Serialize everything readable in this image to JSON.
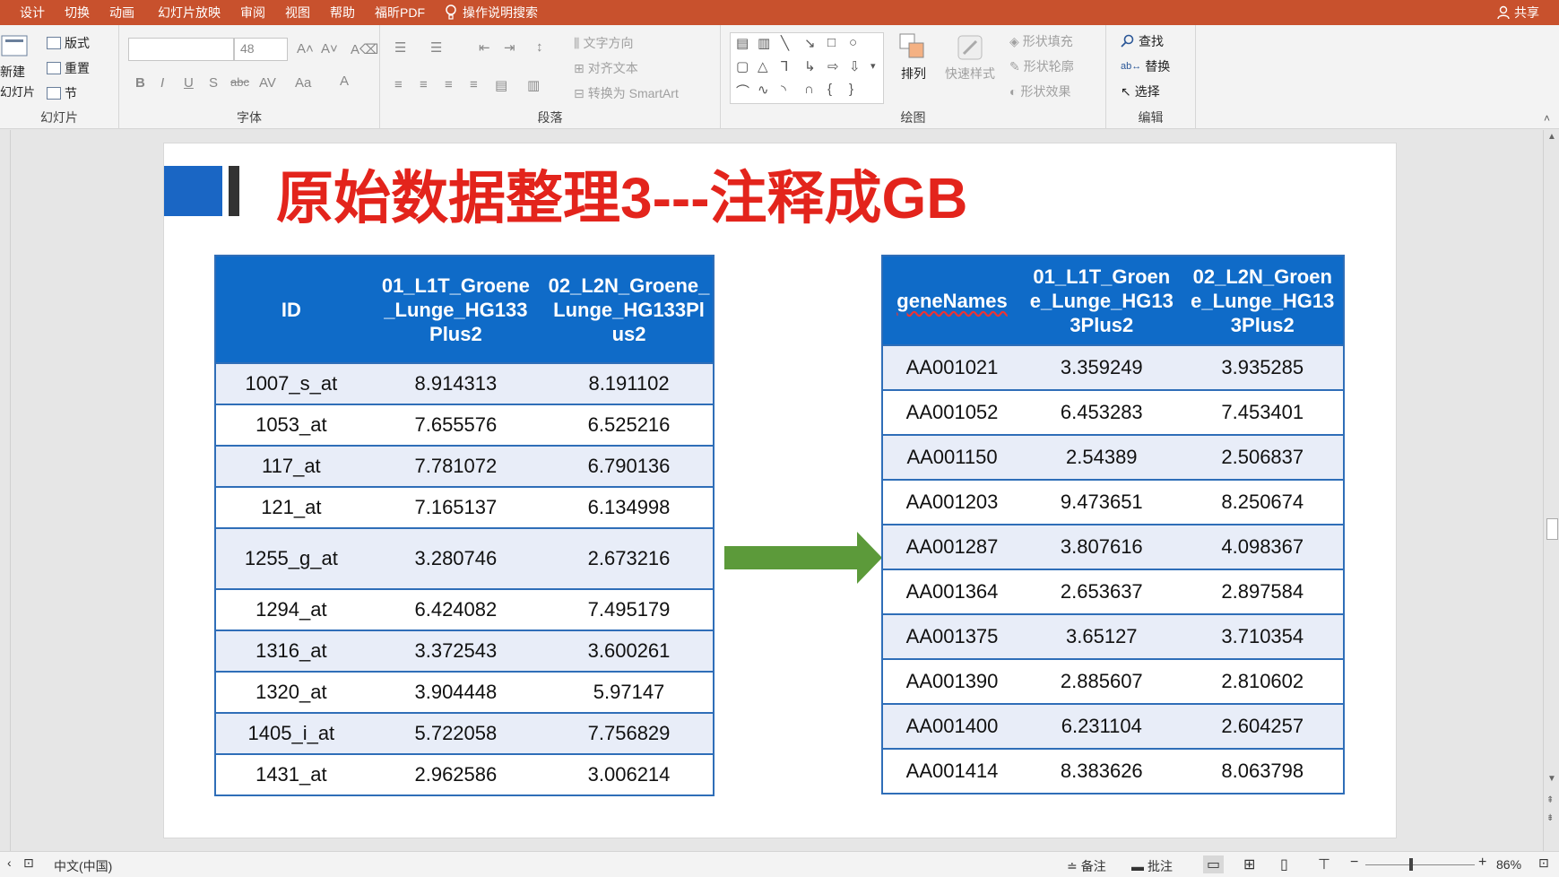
{
  "menu": [
    "设计",
    "切换",
    "动画",
    "幻灯片放映",
    "审阅",
    "视图",
    "帮助",
    "福昕PDF"
  ],
  "tellme": "操作说明搜索",
  "share": "共享",
  "ribbon": {
    "slides_group": {
      "new_slide": "新建",
      "new_slide2": "幻灯片",
      "layout": "版式",
      "reset": "重置",
      "section": "节",
      "label": "幻灯片"
    },
    "font_group": {
      "size": "48",
      "label": "字体"
    },
    "paragraph_group": {
      "text_dir": "文字方向",
      "align_text": "对齐文本",
      "smartart": "转换为 SmartArt",
      "label": "段落"
    },
    "drawing_group": {
      "arrange": "排列",
      "quick_styles": "快速样式",
      "fill": "形状填充",
      "outline": "形状轮廓",
      "effects": "形状效果",
      "label": "绘图"
    },
    "editing_group": {
      "find": "查找",
      "replace": "替换",
      "select": "选择",
      "label": "编辑"
    }
  },
  "slide": {
    "title": "原始数据整理3---注释成GB",
    "left_table": {
      "headers": [
        "ID",
        "01_L1T_Groene_Lunge_HG133Plus2",
        "02_L2N_Groene_Lunge_HG133Plus2"
      ],
      "header_lines": [
        [
          "ID"
        ],
        [
          "01_L1T_Groene",
          "_Lunge_HG133",
          "Plus2"
        ],
        [
          "02_L2N_Groene_",
          "Lunge_HG133Pl",
          "us2"
        ]
      ],
      "rows": [
        [
          "1007_s_at",
          "8.914313",
          "8.191102"
        ],
        [
          "1053_at",
          "7.655576",
          "6.525216"
        ],
        [
          "117_at",
          "7.781072",
          "6.790136"
        ],
        [
          "121_at",
          "7.165137",
          "6.134998"
        ],
        [
          "1255_g_at",
          "3.280746",
          "2.673216"
        ],
        [
          "1294_at",
          "6.424082",
          "7.495179"
        ],
        [
          "1316_at",
          "3.372543",
          "3.600261"
        ],
        [
          "1320_at",
          "3.904448",
          "5.97147"
        ],
        [
          "1405_i_at",
          "5.722058",
          "7.756829"
        ],
        [
          "1431_at",
          "2.962586",
          "3.006214"
        ]
      ]
    },
    "right_table": {
      "headers": [
        "geneNames",
        "01_L1T_Groene_Lunge_HG133Plus2",
        "02_L2N_Groene_Lunge_HG133Plus2"
      ],
      "header_lines": [
        [
          "geneNames"
        ],
        [
          "01_L1T_Groen",
          "e_Lunge_HG13",
          "3Plus2"
        ],
        [
          "02_L2N_Groen",
          "e_Lunge_HG13",
          "3Plus2"
        ]
      ],
      "rows": [
        [
          "AA001021",
          "3.359249",
          "3.935285"
        ],
        [
          "AA001052",
          "6.453283",
          "7.453401"
        ],
        [
          "AA001150",
          "2.54389",
          "2.506837"
        ],
        [
          "AA001203",
          "9.473651",
          "8.250674"
        ],
        [
          "AA001287",
          "3.807616",
          "4.098367"
        ],
        [
          "AA001364",
          "2.653637",
          "2.897584"
        ],
        [
          "AA001375",
          "3.65127",
          "3.710354"
        ],
        [
          "AA001390",
          "2.885607",
          "2.810602"
        ],
        [
          "AA001400",
          "6.231104",
          "2.604257"
        ],
        [
          "AA001414",
          "8.383626",
          "8.063798"
        ]
      ]
    }
  },
  "status": {
    "language": "中文(中国)",
    "notes": "备注",
    "comments": "批注",
    "zoom": "86%"
  },
  "colors": {
    "menubar": "#c8512d",
    "title": "#e3241c",
    "table_header": "#0f6bc8",
    "arrow": "#5c9a3a"
  }
}
